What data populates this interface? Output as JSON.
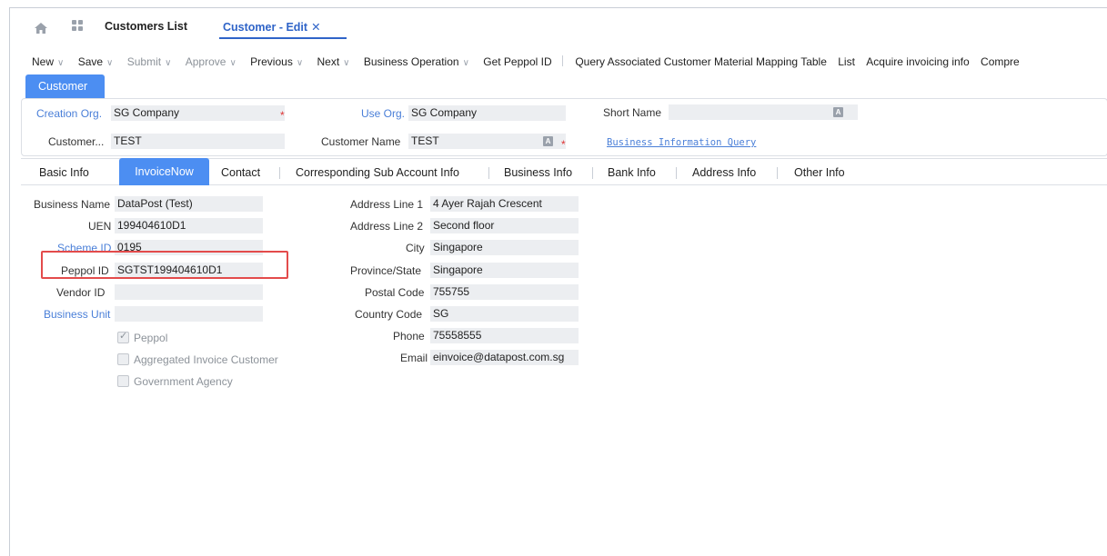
{
  "header": {
    "tabs": [
      {
        "label": "Customers List"
      },
      {
        "label": "Customer - Edit",
        "close": "✕"
      }
    ]
  },
  "toolbar": {
    "items": [
      "New",
      "Save",
      "Submit",
      "Approve",
      "Previous",
      "Next",
      "Business Operation",
      "Get Peppol ID",
      "Query Associated Customer Material Mapping Table",
      "List",
      "Acquire invoicing info",
      "Compre"
    ]
  },
  "customer": {
    "tab_label": "Customer",
    "creation_org_label": "Creation Org.",
    "creation_org_value": "SG Company",
    "use_org_label": "Use Org.",
    "use_org_value": "SG Company",
    "short_name_label": "Short Name",
    "short_name_value": "",
    "customer_code_label": "Customer...",
    "customer_code_value": "TEST",
    "customer_name_label": "Customer Name",
    "customer_name_value": "TEST",
    "business_info_query": "Business Information Query",
    "required_mark": "*",
    "lang_icon": "A"
  },
  "sections": {
    "tabs": [
      "Basic Info",
      "InvoiceNow",
      "Contact",
      "Corresponding Sub Account Info",
      "Business Info",
      "Bank Info",
      "Address Info",
      "Other Info"
    ],
    "active": "InvoiceNow"
  },
  "invoicenow": {
    "business_name_label": "Business Name",
    "business_name_value": "DataPost (Test)",
    "uen_label": "UEN",
    "uen_value": "199404610D1",
    "scheme_id_label": "Scheme ID",
    "scheme_id_value": "0195",
    "peppol_id_label": "Peppol ID",
    "peppol_id_value": "SGTST199404610D1",
    "vendor_id_label": "Vendor ID",
    "vendor_id_value": "",
    "business_unit_label": "Business Unit",
    "business_unit_value": "",
    "checkboxes": [
      {
        "label": "Peppol",
        "checked": true
      },
      {
        "label": "Aggregated Invoice Customer",
        "checked": false
      },
      {
        "label": "Government Agency",
        "checked": false
      }
    ],
    "address_line1_label": "Address Line 1",
    "address_line1_value": "4 Ayer Rajah Crescent",
    "address_line2_label": "Address Line 2",
    "address_line2_value": "Second floor",
    "city_label": "City",
    "city_value": "Singapore",
    "province_label": "Province/State",
    "province_value": "Singapore",
    "postal_label": "Postal Code",
    "postal_value": "755755",
    "country_label": "Country Code",
    "country_value": "SG",
    "phone_label": "Phone",
    "phone_value": "75558555",
    "email_label": "Email",
    "email_value": "einvoice@datapost.com.sg"
  },
  "colors": {
    "accent": "#4c8ef2",
    "link": "#4a7fd8",
    "highlight": "#e34b4b",
    "required": "#e03535"
  }
}
